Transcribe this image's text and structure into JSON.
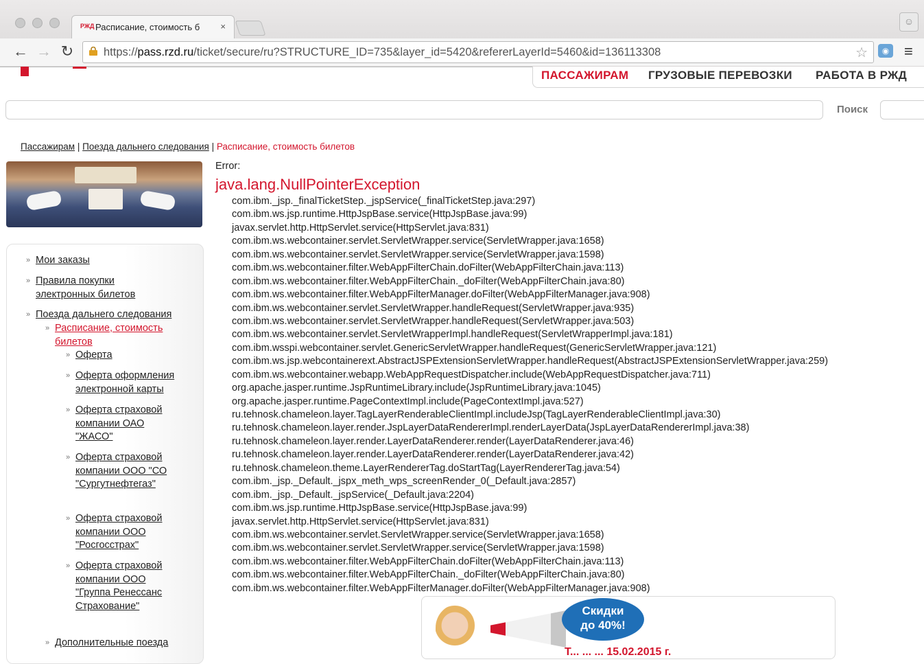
{
  "browser": {
    "tab_title": "Расписание, стоимость б",
    "tab_close": "×",
    "url_prefix": "https://",
    "url_host": "pass.rzd.ru",
    "url_path": "/ticket/secure/ru?STRUCTURE_ID=735&layer_id=5420&refererLayerId=5460&id=136113308",
    "favicon_text": "РЖД"
  },
  "topnav": {
    "passengers": "ПАССАЖИРАМ",
    "freight": "ГРУЗОВЫЕ ПЕРЕВОЗКИ",
    "jobs": "РАБОТА В РЖД"
  },
  "search": {
    "label": "Поиск"
  },
  "breadcrumb": {
    "items": [
      "Пассажирам",
      "Поезда дальнего следования"
    ],
    "separator": "|",
    "current": "Расписание, стоимость билетов"
  },
  "sidebar": {
    "my_orders": "Мои заказы",
    "rules": "Правила покупки электронных билетов",
    "long_distance": "Поезда дальнего следования",
    "schedule": "Расписание, стоимость билетов",
    "offer": "Оферта",
    "offer_card": "Оферта оформления электронной карты",
    "insurance_jaso": "Оферта страховой компании ОАО \"ЖАСО\"",
    "insurance_sogaz": "Оферта страховой компании ООО \"СО \"Сургутнефтегаз\"",
    "insurance_rgs": "Оферта страховой компании ООО \"Росгосстрах\"",
    "insurance_ren": "Оферта страховой компании ООО \"Группа Ренессанс Страхование\"",
    "additional": "Дополнительные поезда"
  },
  "error": {
    "label": "Error:",
    "title": "java.lang.NullPointerException",
    "trace": [
      "com.ibm._jsp._finalTicketStep._jspService(_finalTicketStep.java:297)",
      "com.ibm.ws.jsp.runtime.HttpJspBase.service(HttpJspBase.java:99)",
      "javax.servlet.http.HttpServlet.service(HttpServlet.java:831)",
      "com.ibm.ws.webcontainer.servlet.ServletWrapper.service(ServletWrapper.java:1658)",
      "com.ibm.ws.webcontainer.servlet.ServletWrapper.service(ServletWrapper.java:1598)",
      "com.ibm.ws.webcontainer.filter.WebAppFilterChain.doFilter(WebAppFilterChain.java:113)",
      "com.ibm.ws.webcontainer.filter.WebAppFilterChain._doFilter(WebAppFilterChain.java:80)",
      "com.ibm.ws.webcontainer.filter.WebAppFilterManager.doFilter(WebAppFilterManager.java:908)",
      "com.ibm.ws.webcontainer.servlet.ServletWrapper.handleRequest(ServletWrapper.java:935)",
      "com.ibm.ws.webcontainer.servlet.ServletWrapper.handleRequest(ServletWrapper.java:503)",
      "com.ibm.ws.webcontainer.servlet.ServletWrapperImpl.handleRequest(ServletWrapperImpl.java:181)",
      "com.ibm.wsspi.webcontainer.servlet.GenericServletWrapper.handleRequest(GenericServletWrapper.java:121)",
      "com.ibm.ws.jsp.webcontainerext.AbstractJSPExtensionServletWrapper.handleRequest(AbstractJSPExtensionServletWrapper.java:259)",
      "com.ibm.ws.webcontainer.webapp.WebAppRequestDispatcher.include(WebAppRequestDispatcher.java:711)",
      "org.apache.jasper.runtime.JspRuntimeLibrary.include(JspRuntimeLibrary.java:1045)",
      "org.apache.jasper.runtime.PageContextImpl.include(PageContextImpl.java:527)",
      "ru.tehnosk.chameleon.layer.TagLayerRenderableClientImpl.includeJsp(TagLayerRenderableClientImpl.java:30)",
      "ru.tehnosk.chameleon.layer.render.JspLayerDataRendererImpl.renderLayerData(JspLayerDataRendererImpl.java:38)",
      "ru.tehnosk.chameleon.layer.render.LayerDataRenderer.render(LayerDataRenderer.java:46)",
      "ru.tehnosk.chameleon.layer.render.LayerDataRenderer.render(LayerDataRenderer.java:42)",
      "ru.tehnosk.chameleon.theme.LayerRendererTag.doStartTag(LayerRendererTag.java:54)",
      "com.ibm._jsp._Default._jspx_meth_wps_screenRender_0(_Default.java:2857)",
      "com.ibm._jsp._Default._jspService(_Default.java:2204)",
      "com.ibm.ws.jsp.runtime.HttpJspBase.service(HttpJspBase.java:99)",
      "javax.servlet.http.HttpServlet.service(HttpServlet.java:831)",
      "com.ibm.ws.webcontainer.servlet.ServletWrapper.service(ServletWrapper.java:1658)",
      "com.ibm.ws.webcontainer.servlet.ServletWrapper.service(ServletWrapper.java:1598)",
      "com.ibm.ws.webcontainer.filter.WebAppFilterChain.doFilter(WebAppFilterChain.java:113)",
      "com.ibm.ws.webcontainer.filter.WebAppFilterChain._doFilter(WebAppFilterChain.java:80)",
      "com.ibm.ws.webcontainer.filter.WebAppFilterManager.doFilter(WebAppFilterManager.java:908)"
    ]
  },
  "banner": {
    "bubble_line1": "Скидки",
    "bubble_line2": "до 40%!",
    "promo_text": "Т... ... ... 15.02.2015 г."
  },
  "colors": {
    "brand_red": "#d3162d",
    "bubble_blue": "#1f6fb7"
  }
}
